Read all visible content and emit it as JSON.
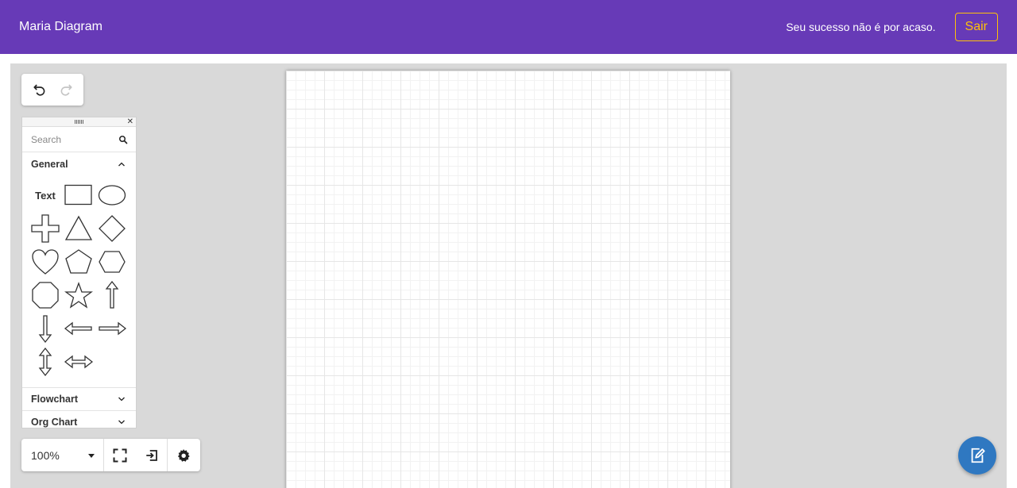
{
  "header": {
    "brand": "Maria Diagram",
    "slogan": "Seu sucesso não é por acaso.",
    "logout_label": "Sair"
  },
  "colors": {
    "header_bg": "#673ab7",
    "accent_outline": "#ffc107",
    "fab_bg": "#2f78c1",
    "canvas_bg": "#d9d9d9"
  },
  "history": {
    "undo_icon": "undo-icon",
    "redo_icon": "redo-icon"
  },
  "shapes_panel": {
    "search_placeholder": "Search",
    "sections": {
      "general": {
        "label": "General",
        "text_shape_label": "Text",
        "shapes": [
          "text",
          "rectangle",
          "ellipse",
          "cross",
          "triangle",
          "diamond",
          "heart",
          "pentagon",
          "hexagon",
          "octagon",
          "star",
          "arrow-up",
          "arrow-down",
          "arrow-left",
          "arrow-right",
          "arrow-up-down",
          "arrow-left-right"
        ]
      },
      "flowchart": {
        "label": "Flowchart"
      },
      "org_chart": {
        "label": "Org Chart"
      }
    }
  },
  "bottom_toolbar": {
    "zoom_value": "100%",
    "tools": [
      "fullscreen-icon",
      "exit-icon",
      "gear-icon"
    ]
  },
  "fab": {
    "icon": "edit-note-icon"
  }
}
